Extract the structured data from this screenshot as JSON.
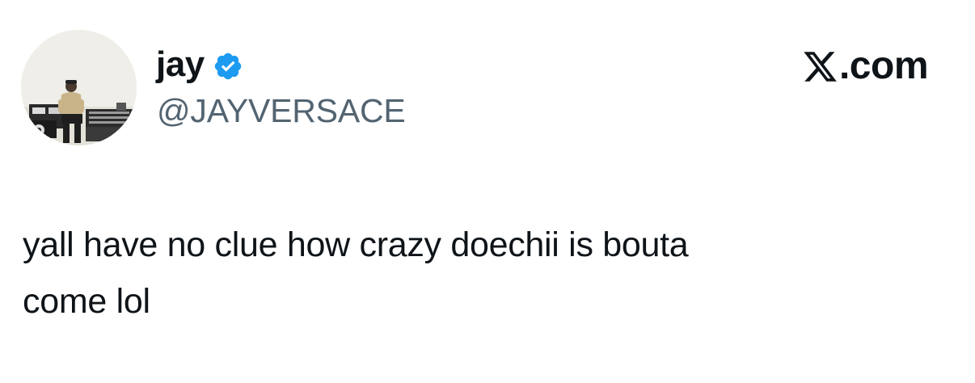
{
  "author": {
    "display_name": "jay",
    "handle": "@JAYVERSACE",
    "verified": true,
    "avatar_icon": "profile-photo",
    "verified_color": "#1d9bf0"
  },
  "site": {
    "logo_icon": "x-logo-icon",
    "domain": ".com"
  },
  "tweet": {
    "lines": [
      "yall have no clue how crazy doechii is bouta",
      "come lol"
    ]
  },
  "colors": {
    "text_primary": "#0f1419",
    "text_secondary": "#536471",
    "background": "#ffffff"
  }
}
